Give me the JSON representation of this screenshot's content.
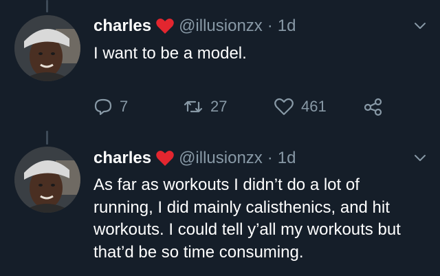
{
  "tweets": [
    {
      "name": "charles",
      "handle": "@illusionzx",
      "separator": "·",
      "time": "1d",
      "text": "I want to be a model.",
      "replies": "7",
      "retweets": "27",
      "likes": "461"
    },
    {
      "name": "charles",
      "handle": "@illusionzx",
      "separator": "·",
      "time": "1d",
      "text": "As far as workouts I didn’t do a lot of running, I did mainly calisthenics, and hit workouts. I could tell y’all my workouts but that’d be so time consuming."
    }
  ],
  "icons": {
    "name_emoji": "heart-icon",
    "reply": "reply-icon",
    "retweet": "retweet-icon",
    "like": "like-icon",
    "share": "share-icon",
    "menu": "chevron-down-icon"
  },
  "colors": {
    "background": "#151e29",
    "secondary_text": "#8899a6",
    "heart": "#e3262f"
  }
}
